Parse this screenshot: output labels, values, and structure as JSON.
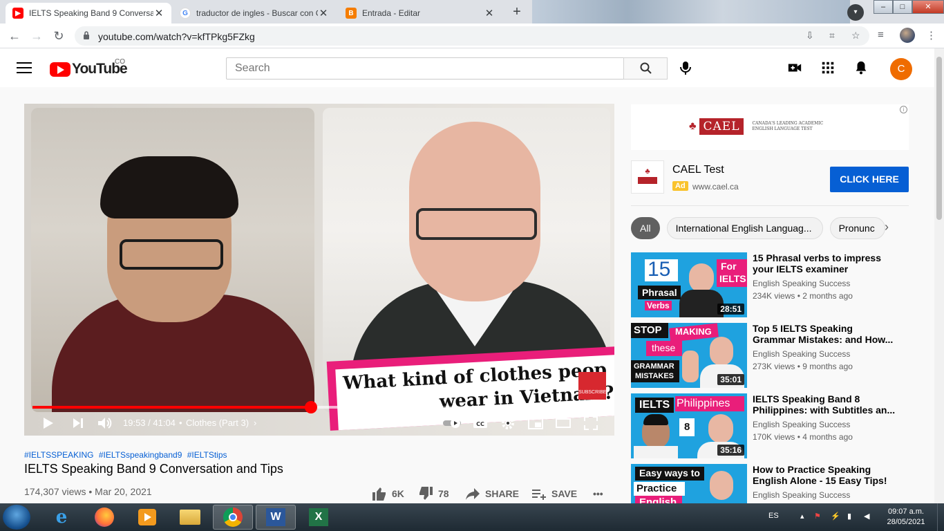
{
  "browser": {
    "tabs": [
      {
        "title": "IELTS Speaking Band 9 Conversat",
        "favicon": "youtube-icon"
      },
      {
        "title": "traductor de ingles - Buscar con G",
        "favicon": "google-icon"
      },
      {
        "title": "Entrada - Editar",
        "favicon": "blogger-icon"
      }
    ],
    "window_controls": {
      "minimize": "–",
      "maximize": "□",
      "close": "✕"
    },
    "url": "youtube.com/watch?v=kfTPkg5FZkg"
  },
  "youtube": {
    "logo_text": "YouTube",
    "country_code": "CO",
    "search_placeholder": "Search",
    "user_initial": "C"
  },
  "video": {
    "caption_line1": "What kind of clothes peop",
    "caption_line2": "wear in Vietnam?",
    "subscribe_badge": "SUBSCRIBE",
    "progress_played_fraction": 0.486,
    "progress_loaded_fraction": 0.545,
    "time_current": "19:53",
    "time_total": "41:04",
    "time_display": "19:53 / 41:04",
    "chapter": "Clothes (Part 3)",
    "hashtags": [
      "#IELTSSPEAKING",
      "#IELTSspeakingband9",
      "#IELTStips"
    ],
    "title": "IELTS Speaking Band 9 Conversation and Tips",
    "views_date": "174,307 views • Mar 20, 2021",
    "likes": "6K",
    "dislikes": "78",
    "share_label": "SHARE",
    "save_label": "SAVE"
  },
  "ad": {
    "banner_brand": "CAEL",
    "banner_tagline_1": "CANADA'S LEADING ACADEMIC",
    "banner_tagline_2": "ENGLISH LANGUAGE TEST",
    "name": "CAEL Test",
    "label": "Ad",
    "url": "www.cael.ca",
    "cta": "CLICK HERE"
  },
  "chips": [
    "All",
    "International English Languag...",
    "Pronunc"
  ],
  "recommendations": [
    {
      "title": "15 Phrasal verbs to impress your IELTS examiner",
      "channel": "English Speaking Success",
      "stats": "234K views • 2 months ago",
      "duration": "28:51",
      "thumb_text": [
        "15",
        "For",
        "IELTS",
        "Phrasal",
        "Verbs"
      ]
    },
    {
      "title": "Top 5 IELTS Speaking Grammar Mistakes: and How...",
      "channel": "English Speaking Success",
      "stats": "273K views • 9 months ago",
      "duration": "35:01",
      "thumb_text": [
        "STOP",
        "MAKING",
        "these",
        "GRAMMAR",
        "MISTAKES"
      ]
    },
    {
      "title": "IELTS Speaking Band 8 Philippines: with Subtitles an...",
      "channel": "English Speaking Success",
      "stats": "170K views • 4 months ago",
      "duration": "35:16",
      "thumb_text": [
        "IELTS",
        "Philippines",
        "8"
      ]
    },
    {
      "title": "How to Practice Speaking English Alone - 15 Easy Tips!",
      "channel": "English Speaking Success",
      "stats": "",
      "duration": "",
      "thumb_text": [
        "Easy ways to",
        "Practice",
        "English"
      ]
    }
  ],
  "taskbar": {
    "apps": [
      "internet-explorer",
      "firefox",
      "media-player",
      "file-explorer",
      "chrome",
      "word",
      "excel"
    ],
    "word_letter": "W",
    "excel_letter": "X",
    "language": "ES",
    "time": "09:07 a.m.",
    "date": "28/05/2021"
  },
  "colors": {
    "youtube_red": "#ff0000",
    "link_blue": "#065fd4",
    "ad_yellow": "#f9c32d",
    "avatar_orange": "#ef6c00",
    "banner_pink": "#e91e7a"
  }
}
